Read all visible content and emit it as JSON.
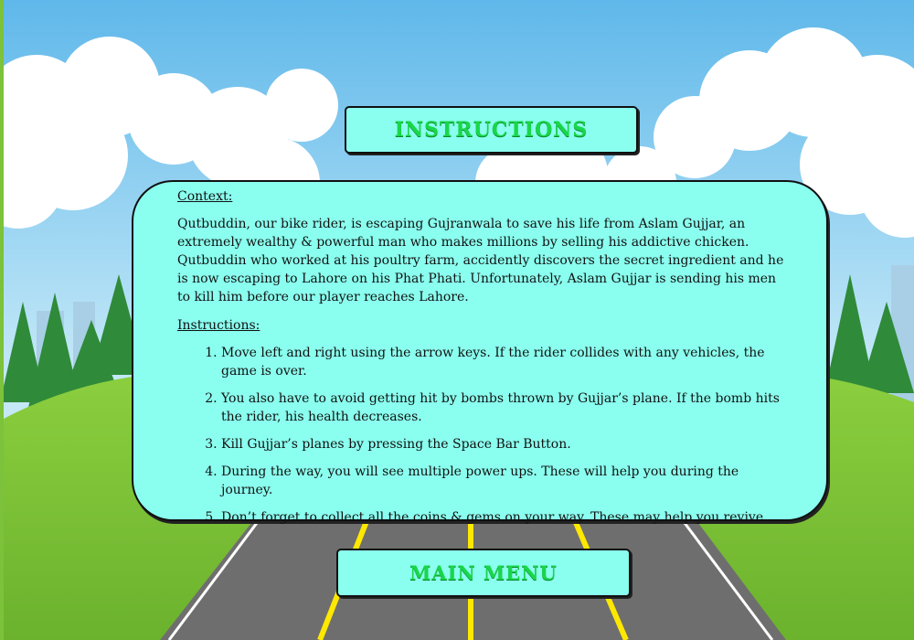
{
  "title": "INSTRUCTIONS",
  "context": {
    "heading": "Context:",
    "body": "Qutbuddin, our bike rider, is escaping Gujranwala to save his life from Aslam Gujjar, an extremely wealthy & powerful man who makes millions by selling his addictive chicken. Qutbuddin who worked at his poultry farm, accidently discovers the secret ingredient and he is now escaping to Lahore on his Phat Phati. Unfortunately, Aslam Gujjar is sending his men to kill him before our player reaches Lahore."
  },
  "instructions": {
    "heading": "Instructions:",
    "items": [
      "Move left and right using the arrow keys. If the rider collides with any vehicles, the game is over.",
      "You also have to avoid getting hit by bombs thrown by Gujjar’s plane. If the bomb hits the rider, his health decreases.",
      "Kill Gujjar’s planes by pressing the Space Bar Button.",
      "During the way, you will see multiple power ups. These will help you during the journey.",
      " Don’t forget to collect all the coins & gems on your way. These may help you revive"
    ]
  },
  "main_menu_label": "MAIN MENU",
  "colors": {
    "panel": "#8affef",
    "title_text": "#19d64a",
    "sky": "#8fd0ef",
    "grass": "#7cc23a",
    "road": "#6e6e6e",
    "lane": "#ffe800"
  }
}
